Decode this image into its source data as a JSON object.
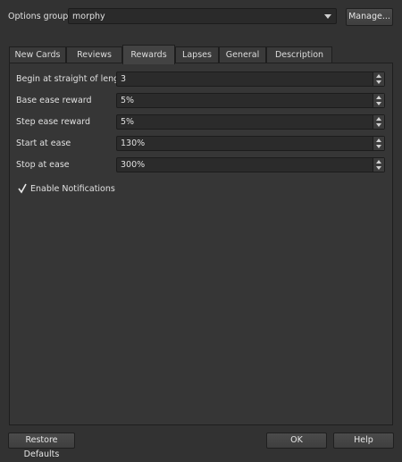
{
  "options_group": {
    "label": "Options group:",
    "selected": "morphy",
    "manage_label": "Manage..."
  },
  "tabs": [
    {
      "label": "New Cards"
    },
    {
      "label": "Reviews"
    },
    {
      "label": "Rewards",
      "active": true
    },
    {
      "label": "Lapses"
    },
    {
      "label": "General"
    },
    {
      "label": "Description"
    }
  ],
  "rewards": {
    "fields": [
      {
        "label": "Begin at straight of length",
        "value": "3"
      },
      {
        "label": "Base ease reward",
        "value": "5%"
      },
      {
        "label": "Step ease reward",
        "value": "5%"
      },
      {
        "label": "Start at ease",
        "value": "130%"
      },
      {
        "label": "Stop at ease",
        "value": "300%"
      }
    ],
    "enable_notifications": {
      "label": "Enable Notifications",
      "checked": true
    }
  },
  "buttons": {
    "restore": "Restore Defaults",
    "ok": "OK",
    "help": "Help"
  }
}
